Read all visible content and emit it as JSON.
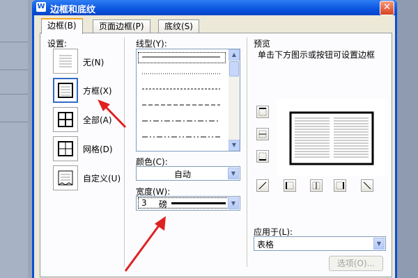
{
  "dialog": {
    "title": "边框和底纹",
    "close": "✕"
  },
  "tabs": [
    {
      "label": "边框(B)"
    },
    {
      "label": "页面边框(P)"
    },
    {
      "label": "底纹(S)"
    }
  ],
  "settings": {
    "heading": "设置:",
    "presets": [
      {
        "label": "无(N)"
      },
      {
        "label": "方框(X)"
      },
      {
        "label": "全部(A)"
      },
      {
        "label": "网格(D)"
      },
      {
        "label": "自定义(U)"
      }
    ],
    "selected_index": 1
  },
  "line_style": {
    "heading": "线型(Y):"
  },
  "color": {
    "label": "颜色(C):",
    "value": "自动"
  },
  "width": {
    "label": "宽度(W):",
    "value": "3",
    "unit": "磅"
  },
  "preview": {
    "heading": "预览",
    "hint": "单击下方图示或按钮可设置边框"
  },
  "apply_to": {
    "label": "应用于(L):",
    "value": "表格"
  },
  "options_button": {
    "label": "选项(O)..."
  },
  "annotations": {
    "arrow_color": "#e02020"
  },
  "colors": {
    "title_bar": "#0a54e0",
    "dialog_face": "#ece9d8",
    "selection": "#316ac5"
  }
}
